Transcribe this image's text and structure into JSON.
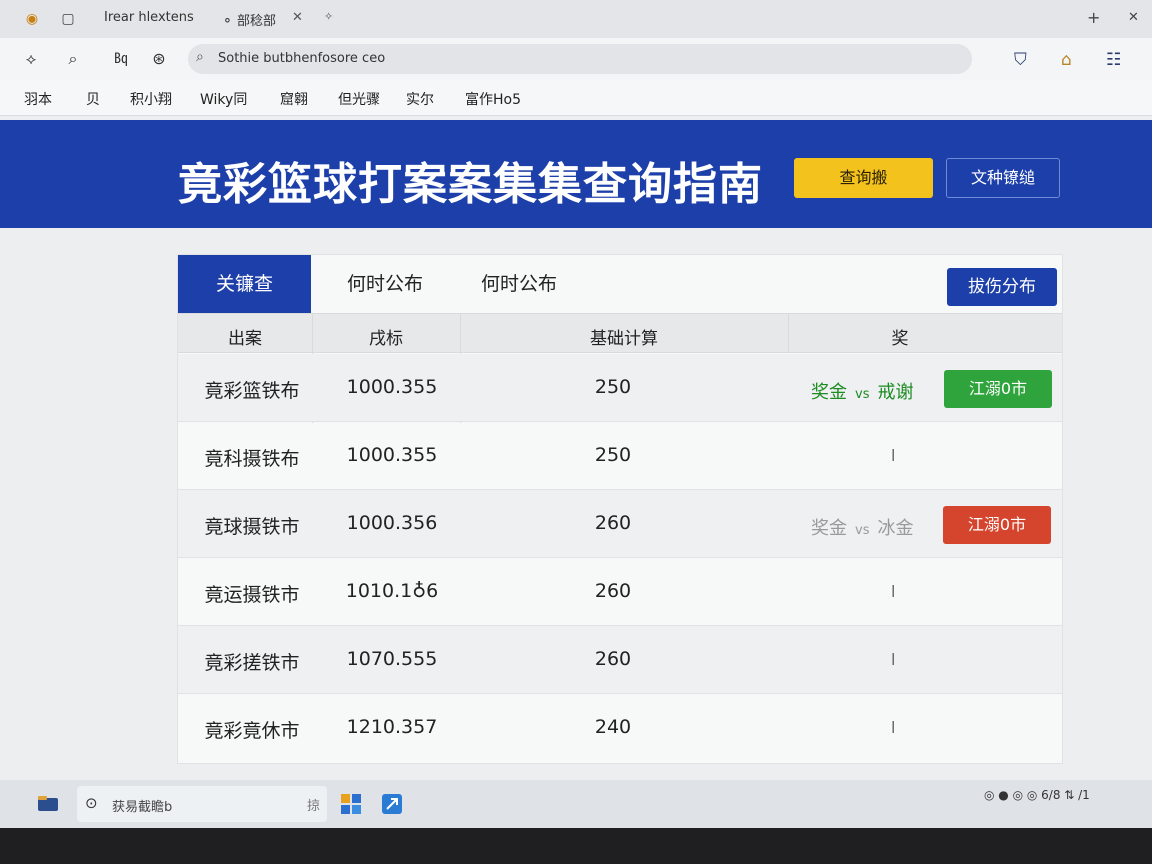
{
  "browser": {
    "tabs": [
      {
        "label": "Irear hlextens"
      },
      {
        "label": "部稔部"
      }
    ],
    "url": "Sothie butbhenfosore ceo",
    "bookmarks": [
      "羽本",
      "贝",
      "积小翔",
      "Wiky同",
      "窟翱",
      "但光骤",
      "实尔",
      "富作Ho5"
    ]
  },
  "hero": {
    "title": "竟彩篮球打案案集集查询指南",
    "query_button": "查询搬",
    "doc_button": "文种镣缒"
  },
  "panel": {
    "tabs": [
      "关镰查",
      "何时公布",
      "何时公布"
    ],
    "dist_button": "拔伤分布",
    "columns": [
      "出案",
      "戌标",
      "基础计算",
      "奖"
    ],
    "rows": [
      {
        "name": "竟彩篮铁布",
        "value": "1000.355",
        "base": "250",
        "award": {
          "type": "pair",
          "left": "奖金",
          "vs": "vs",
          "right": "戒谢",
          "color": "green"
        },
        "button": {
          "label": "江溺0市",
          "color": "green"
        }
      },
      {
        "name": "竟科摄铁布",
        "value": "1000.355",
        "base": "250",
        "award": {
          "type": "dash",
          "text": "l"
        }
      },
      {
        "name": "竟球摄铁市",
        "value": "1000.356",
        "base": "260",
        "award": {
          "type": "pair",
          "left": "奖金",
          "vs": "vs",
          "right": "冰金",
          "color": "gray"
        },
        "button": {
          "label": "江溺0市",
          "color": "red"
        }
      },
      {
        "name": "竟运摄铁市",
        "value": "1010.1♁6",
        "base": "260",
        "award": {
          "type": "dash",
          "text": "l"
        }
      },
      {
        "name": "竟彩搓铁市",
        "value": "1070.555",
        "base": "260",
        "award": {
          "type": "dash",
          "text": "l"
        }
      },
      {
        "name": "竟彩竟休市",
        "value": "1210.357",
        "base": "240",
        "award": {
          "type": "dash",
          "text": "l"
        }
      }
    ]
  },
  "taskbar": {
    "search_text": "获易截瞻b",
    "search_btn": "掠",
    "tray": "◎ ● ◎ ◎ 6/8 ⇅ /1"
  },
  "colors": {
    "brand_blue": "#1d3fa9",
    "gold": "#f4c21c",
    "green": "#2fa43c",
    "red": "#d5452d"
  }
}
